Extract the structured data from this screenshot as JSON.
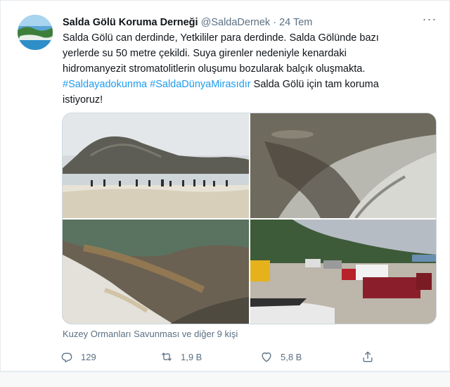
{
  "tweet": {
    "author_name": "Salda Gölü Koruma Derneği",
    "handle": "@SaldaDernek",
    "separator": "·",
    "time": "24 Tem",
    "more_label": "···",
    "text_lines": [
      "Salda Gölü can derdinde, Yetkililer para derdinde. Salda Gölünde bazı",
      "yerlerde su 50 metre çekildi. Suya girenler nedeniyle kenardaki",
      "hidromanyezit stromatolitlerin oluşumu bozularak balçık oluşmakta."
    ],
    "hashtags": [
      "#Saldayadokunma",
      "#SaldaDünyaMirasıdır"
    ],
    "text_after_hashtags": " Salda Gölü için tam koruma",
    "text_last_line": "istiyoruz!",
    "media_alt": [
      "People wading in shallow lake water in front of a mountain",
      "Eroded white shoreline with muddy dark area",
      "White mineral shoreline with dry grass",
      "Crowded parking area with cars near the lake"
    ],
    "liked_by": "Kuzey Ormanları Savunması ve diğer 9 kişi",
    "replies": "129",
    "retweets": "1,9 B",
    "likes": "5,8 B"
  },
  "icons": {
    "reply": "reply-icon",
    "retweet": "retweet-icon",
    "like": "heart-icon",
    "share": "share-icon",
    "more": "more-icon"
  },
  "colors": {
    "text": "#0f1419",
    "secondary": "#5b7083",
    "link": "#1d9bf0",
    "border": "#e6ecf0"
  }
}
